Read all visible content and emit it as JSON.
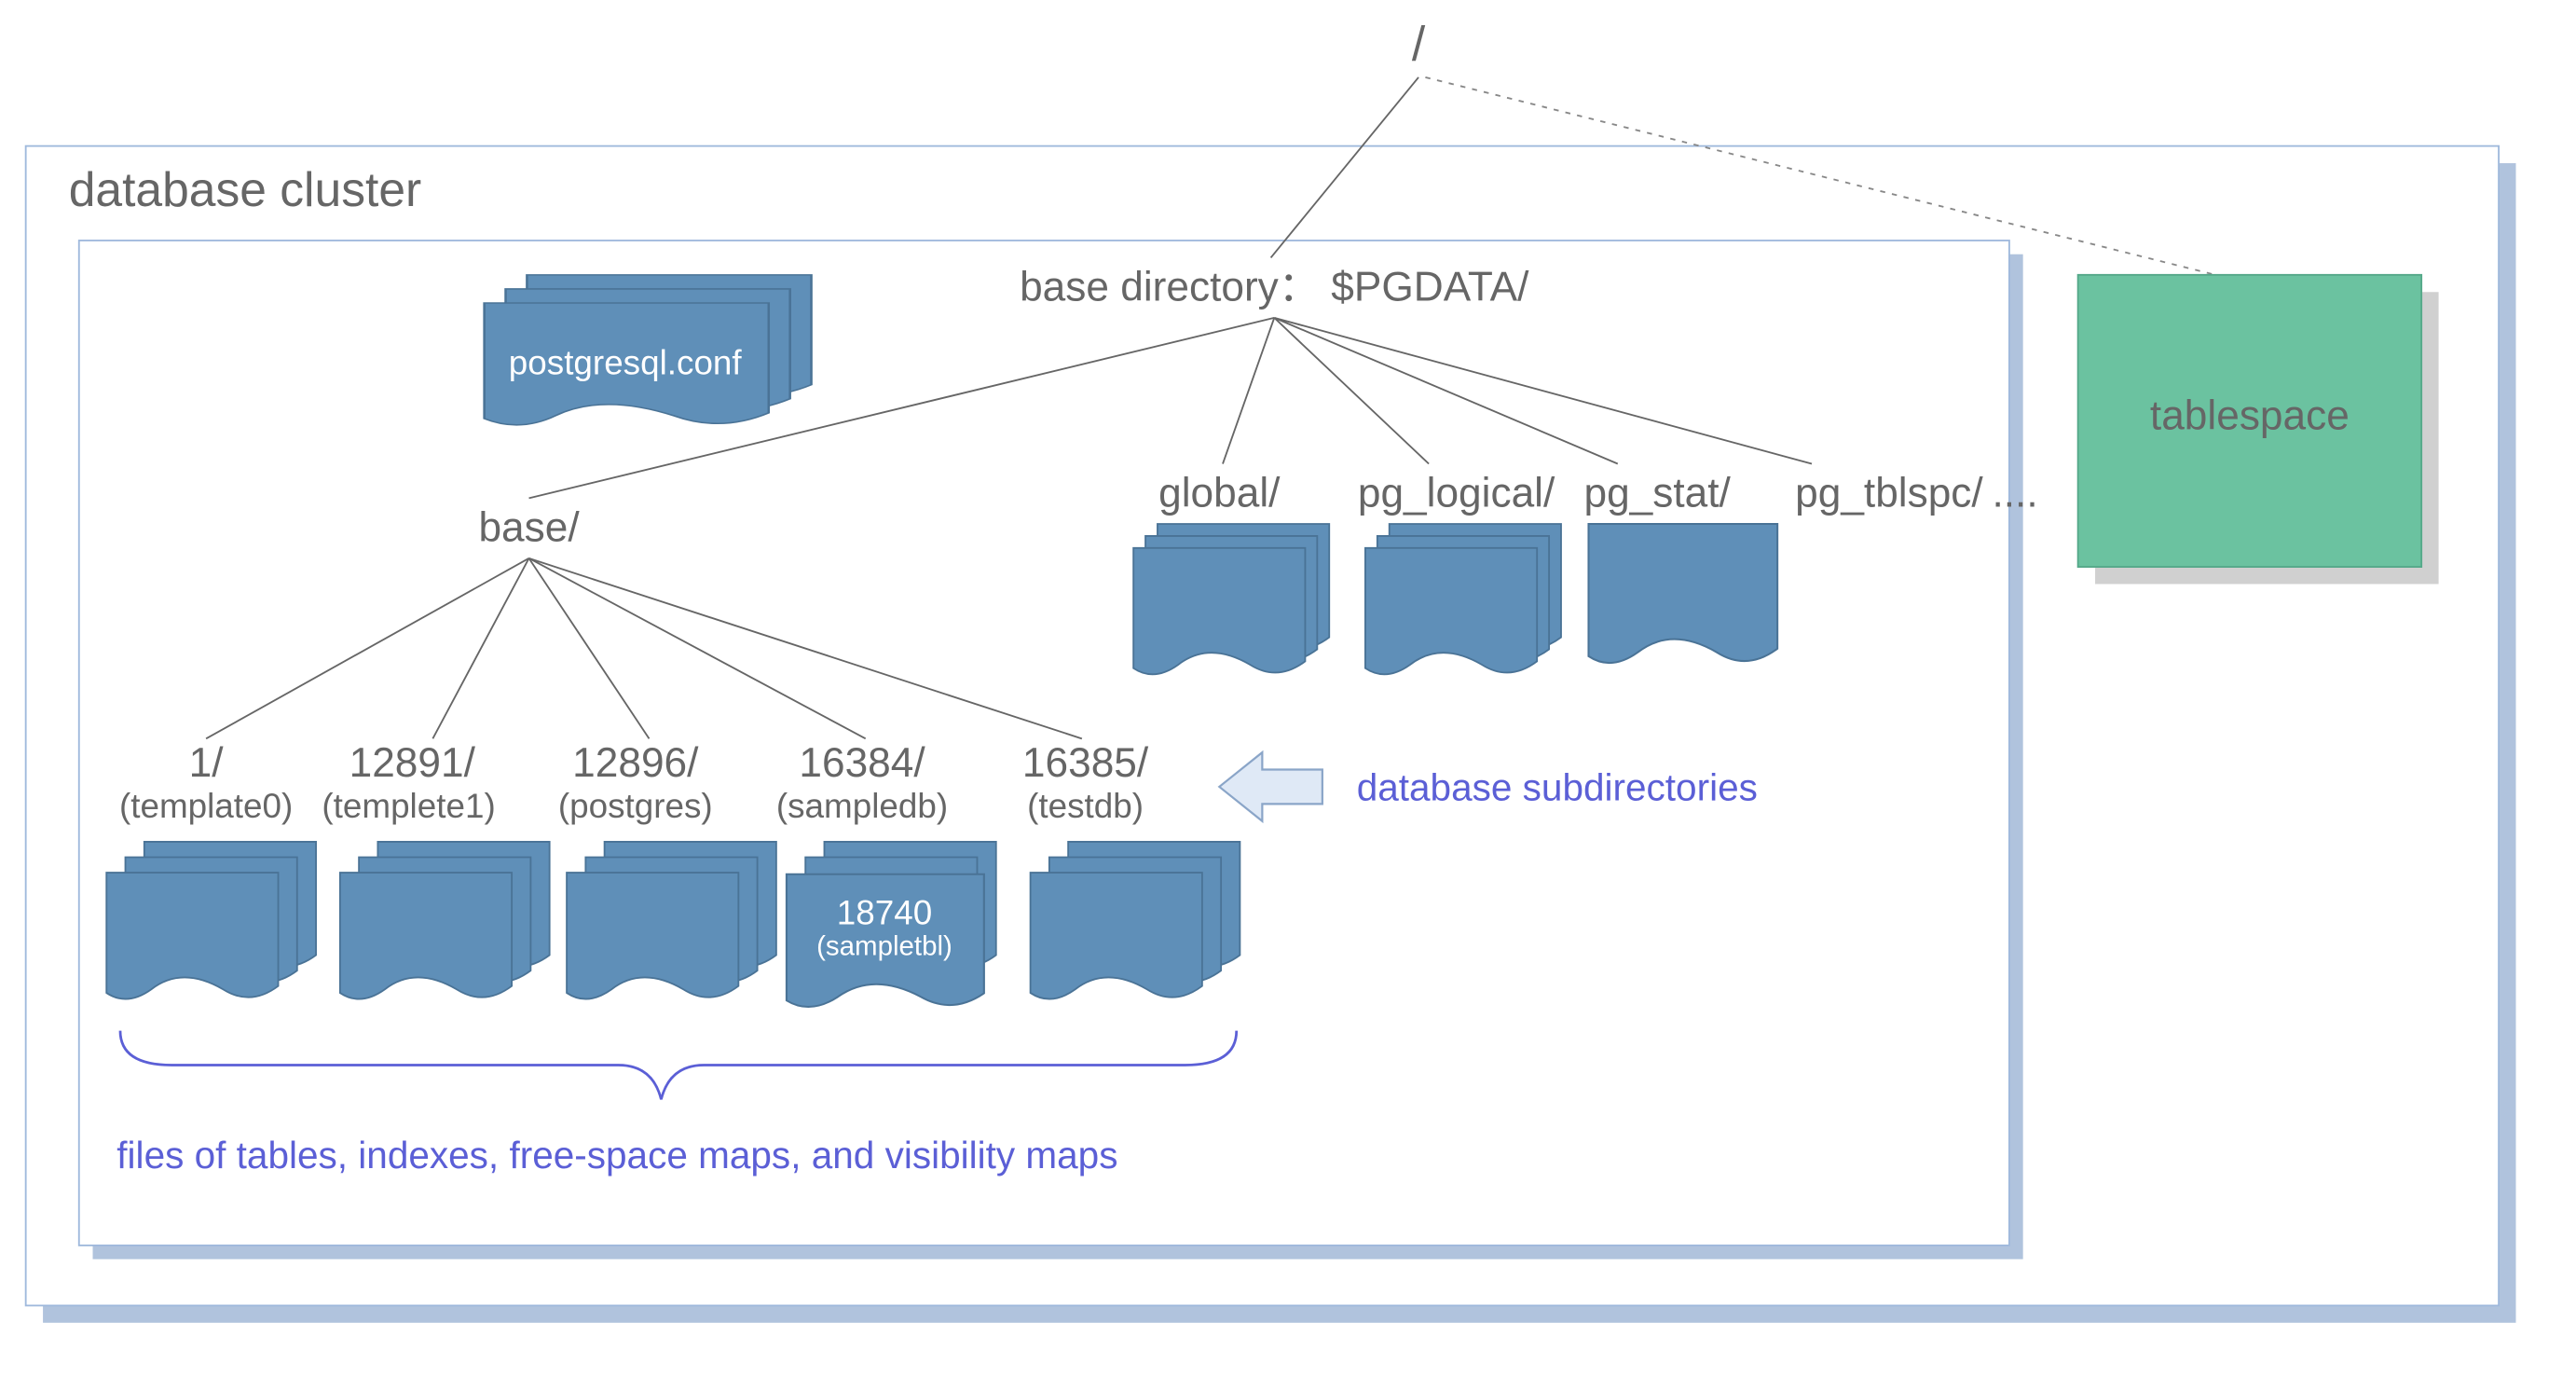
{
  "root": {
    "label": "/"
  },
  "cluster": {
    "title": "database cluster"
  },
  "base_directory": {
    "label": "base directory： $PGDATA/"
  },
  "config_file": {
    "label": "postgresql.conf"
  },
  "tablespace": {
    "label": "tablespace"
  },
  "base_dir": {
    "label": "base/"
  },
  "other_dirs": {
    "global": {
      "label": "global/"
    },
    "pg_logical": {
      "label": "pg_logical/"
    },
    "pg_stat": {
      "label": "pg_stat/"
    },
    "pg_tblspc": {
      "label": "pg_tblspc/"
    },
    "ellipsis": {
      "label": "...."
    }
  },
  "databases": [
    {
      "dir": "1/",
      "name": "(template0)"
    },
    {
      "dir": "12891/",
      "name": "(templete1)"
    },
    {
      "dir": "12896/",
      "name": "(postgres)"
    },
    {
      "dir": "16384/",
      "name": "(sampledb)"
    },
    {
      "dir": "16385/",
      "name": "(testdb)"
    }
  ],
  "sample_table": {
    "oid": "18740",
    "name": "(sampletbl)"
  },
  "caption_subdirs": "database subdirectories",
  "caption_files": "files of tables, indexes, free-space maps, and visibility maps",
  "colors": {
    "folder_fill": "#5f8fb8",
    "folder_stroke": "#4a7396",
    "tablespace_fill": "#6bc2a0",
    "tablespace_stroke": "#55a889",
    "shadow": "#b0c3dd",
    "shadow_grey": "#d0d0d0",
    "box_border": "#9fb9dc",
    "arrow_fill": "#dfe9f6",
    "arrow_stroke": "#8aa5c8"
  }
}
